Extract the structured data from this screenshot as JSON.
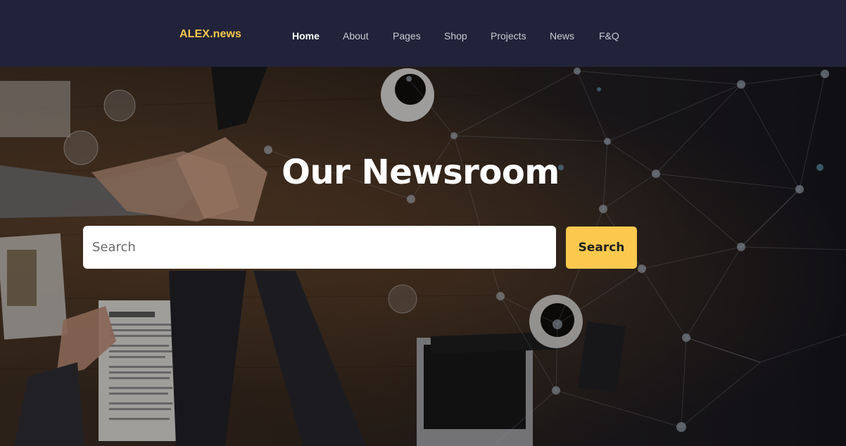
{
  "brand": {
    "name": "ALEX.news",
    "color": "#f7c84b"
  },
  "nav": {
    "items": [
      {
        "label": "Home",
        "active": true
      },
      {
        "label": "About"
      },
      {
        "label": "Pages"
      },
      {
        "label": "Shop"
      },
      {
        "label": "Projects"
      },
      {
        "label": "News"
      },
      {
        "label": "F&Q"
      }
    ]
  },
  "hero": {
    "title": "Our Newsroom",
    "background_image": "team-hands-on-desk-with-network-overlay"
  },
  "search": {
    "placeholder": "Search",
    "value": "",
    "button_label": "Search",
    "button_color": "#fcc94e"
  }
}
